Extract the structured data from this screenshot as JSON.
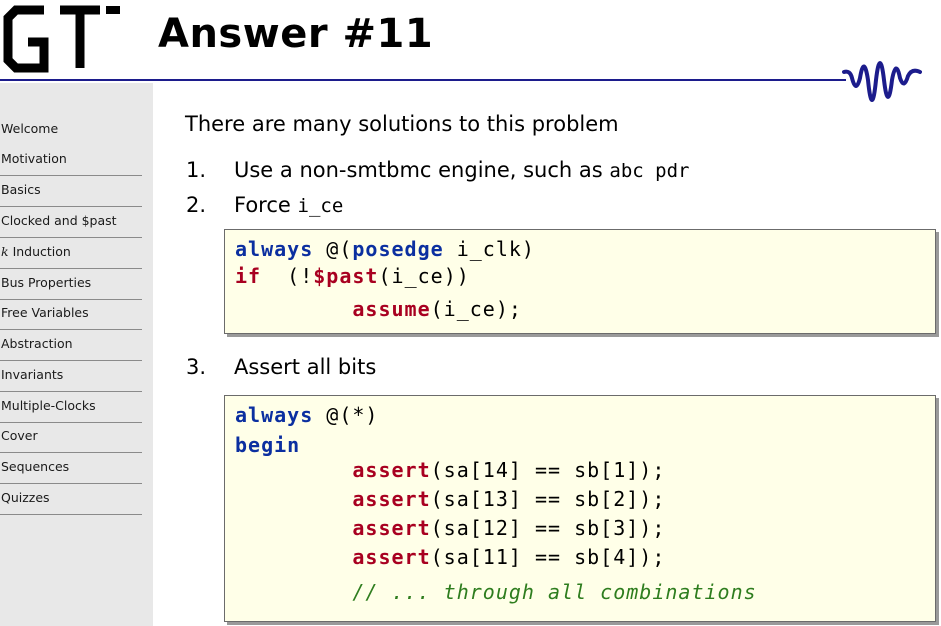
{
  "header": {
    "title": "Answer #11"
  },
  "sidebar": {
    "items": [
      {
        "label": "Welcome"
      },
      {
        "label": "Motivation"
      },
      {
        "label": "Basics"
      },
      {
        "label": "Clocked and $past"
      },
      {
        "label_var": "k",
        "label": "Induction"
      },
      {
        "label": "Bus Properties"
      },
      {
        "label": "Free Variables"
      },
      {
        "label": "Abstraction"
      },
      {
        "label": "Invariants"
      },
      {
        "label": "Multiple-Clocks"
      },
      {
        "label": "Cover"
      },
      {
        "label": "Sequences"
      },
      {
        "label": "Quizzes"
      }
    ]
  },
  "main": {
    "intro": "There are many solutions to this problem",
    "list": [
      {
        "num": "1.",
        "text": "Use a non-smtbmc engine, such as",
        "code": "abc pdr"
      },
      {
        "num": "2.",
        "text": "Force",
        "code": "i_ce"
      },
      {
        "num": "3.",
        "text": "Assert all bits"
      }
    ],
    "code1": {
      "l1_kw": "always",
      "l1_at": " @(",
      "l1_kw2": "posedge",
      "l1_rest": " i_clk)",
      "l2_kw": "if",
      "l2_a": "  (!",
      "l2_fn": "$past",
      "l2_b": "(i_ce))",
      "l3_indent": "         ",
      "l3_fn": "assume",
      "l3_rest": "(i_ce);"
    },
    "code2": {
      "l1_kw": "always",
      "l1_rest": " @(*)",
      "l2_kw": "begin",
      "indent": "         ",
      "fn": "assert",
      "asserts": [
        "(sa[14] == sb[1]);",
        "(sa[13] == sb[2]);",
        "(sa[12] == sb[3]);",
        "(sa[11] == sb[4]);"
      ],
      "comment": "// ... through all combinations"
    }
  }
}
